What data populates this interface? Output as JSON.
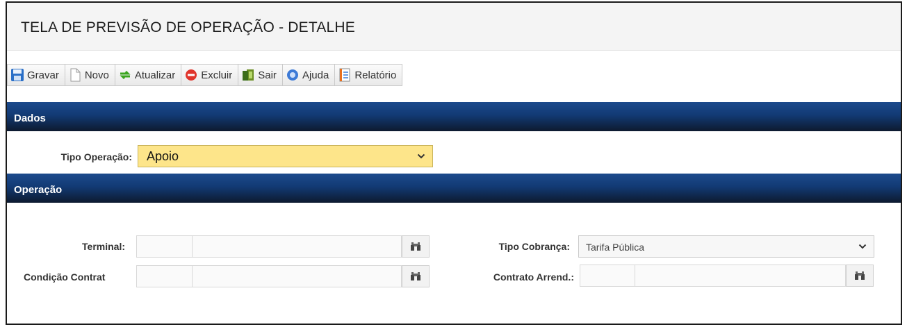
{
  "page": {
    "title": "TELA DE PREVISÃO DE OPERAÇÃO - DETALHE"
  },
  "toolbar": {
    "buttons": [
      {
        "label": "Gravar",
        "icon": "save-icon"
      },
      {
        "label": "Novo",
        "icon": "new-document-icon"
      },
      {
        "label": "Atualizar",
        "icon": "refresh-icon"
      },
      {
        "label": "Excluir",
        "icon": "delete-icon"
      },
      {
        "label": "Sair",
        "icon": "exit-door-icon"
      },
      {
        "label": "Ajuda",
        "icon": "help-icon"
      },
      {
        "label": "Relatório",
        "icon": "report-icon"
      }
    ]
  },
  "sections": {
    "dados": {
      "title": "Dados"
    },
    "operacao": {
      "title": "Operação"
    }
  },
  "form": {
    "tipo_operacao": {
      "label": "Tipo Operação:",
      "value": "Apoio"
    },
    "terminal": {
      "label": "Terminal:"
    },
    "condicao_contrato": {
      "label": "Condição Contrat"
    },
    "tipo_cobranca": {
      "label": "Tipo Cobrança:",
      "value": "Tarifa Pública"
    },
    "contrato_arrend": {
      "label": "Contrato Arrend.:"
    }
  },
  "colors": {
    "header_blue": "#123a74",
    "highlight_yellow": "#fde58a"
  }
}
